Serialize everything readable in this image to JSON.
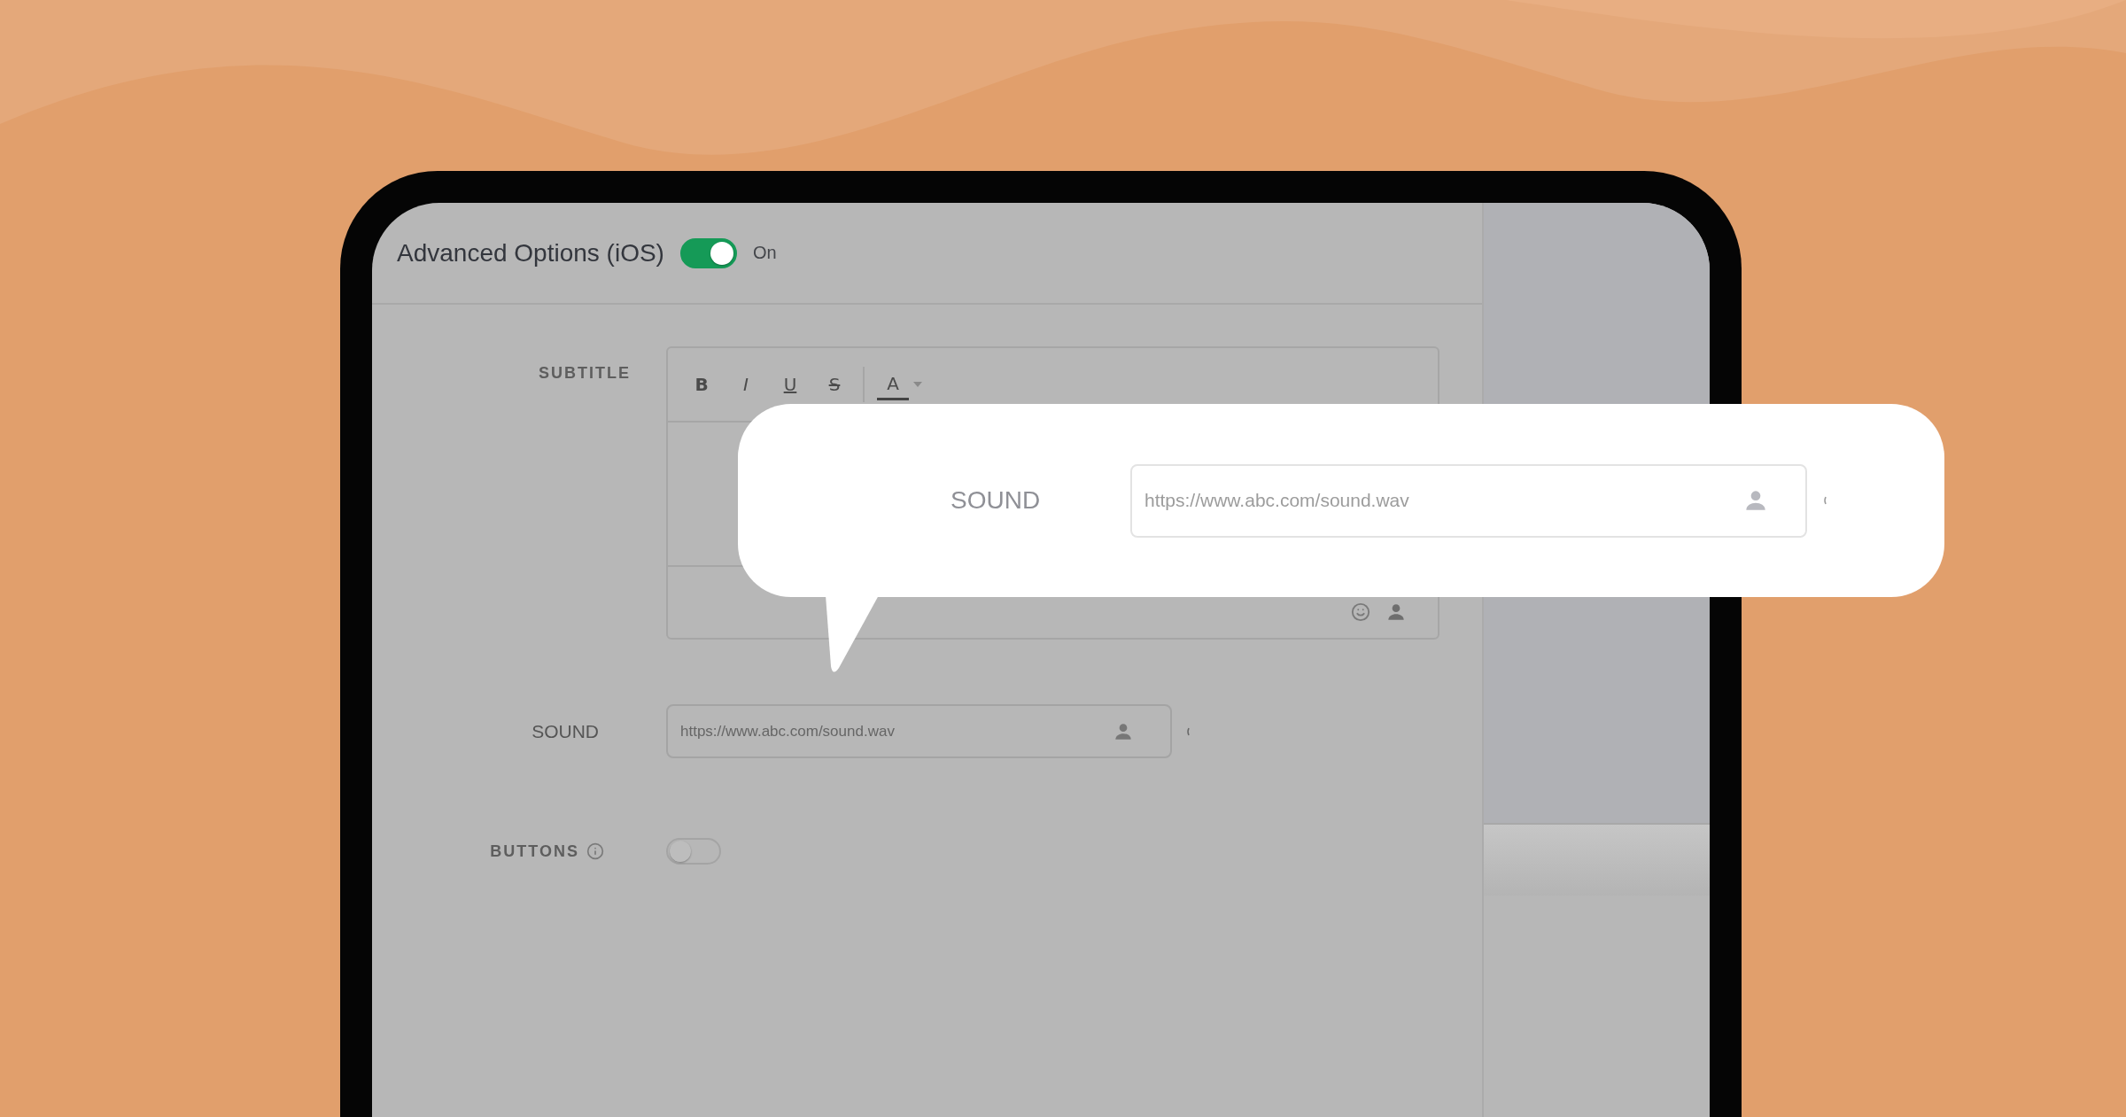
{
  "header": {
    "title": "Advanced Options (iOS)",
    "toggle": {
      "on": true
    },
    "toggle_label": "On"
  },
  "subtitle": {
    "label": "SUBTITLE",
    "toolbar": [
      {
        "kind": "bold",
        "label": "B"
      },
      {
        "kind": "italic",
        "label": "I"
      },
      {
        "kind": "underline",
        "label": "U"
      },
      {
        "kind": "strike",
        "label": "S"
      },
      {
        "kind": "color",
        "label": "A"
      }
    ]
  },
  "sound": {
    "label": "SOUND",
    "placeholder": "https://www.abc.com/sound.wav"
  },
  "buttons": {
    "label": "BUTTONS",
    "toggle": {
      "on": false
    }
  },
  "callout": {
    "label": "SOUND",
    "placeholder": "https://www.abc.com/sound.wav"
  }
}
